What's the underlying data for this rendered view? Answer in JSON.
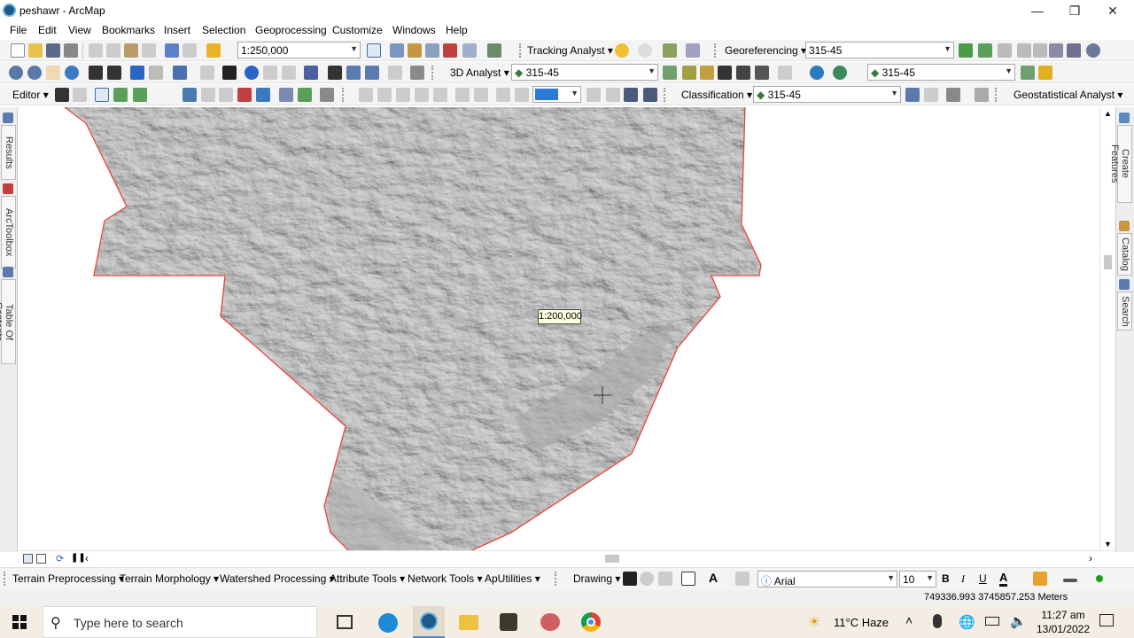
{
  "window": {
    "title": "peshawr - ArcMap"
  },
  "menu": [
    "File",
    "Edit",
    "View",
    "Bookmarks",
    "Insert",
    "Selection",
    "Geoprocessing",
    "Customize",
    "Windows",
    "Help"
  ],
  "toolbar1": {
    "scale_value": "1:250,000",
    "tracking_analyst": "Tracking Analyst",
    "georeferencing": "Georeferencing",
    "georef_layer": "315-45"
  },
  "toolbar2": {
    "analyst_3d": "3D Analyst",
    "layer_3d": "315-45",
    "layer_right": "315-45"
  },
  "toolbar3": {
    "editor": "Editor",
    "classification": "Classification",
    "classification_layer": "315-45",
    "geostatistical": "Geostatistical Analyst"
  },
  "left_dock": {
    "results": "Results",
    "arctoolbox": "ArcToolbox",
    "toc": "Table Of Contents"
  },
  "right_dock": {
    "create_features": "Create Features",
    "catalog": "Catalog",
    "search": "Search"
  },
  "map": {
    "scale_tooltip": "1:200,000",
    "boundary_color": "#e8453c"
  },
  "bottom_toolbar": {
    "terrain_preprocessing": "Terrain Preprocessing",
    "terrain_morphology": "Terrain Morphology",
    "watershed_processing": "Watershed Processing",
    "attribute_tools": "Attribute Tools",
    "network_tools": "Network Tools",
    "aputilities": "ApUtilities",
    "drawing": "Drawing",
    "font_name": "Arial",
    "font_size": "10",
    "bold": "B",
    "italic": "I",
    "underline": "U"
  },
  "status": {
    "coordinates": "749336.993  3745857.253 Meters"
  },
  "taskbar": {
    "search_placeholder": "Type here to search",
    "weather": "11°C  Haze",
    "time": "11:27 am",
    "date": "13/01/2022"
  }
}
